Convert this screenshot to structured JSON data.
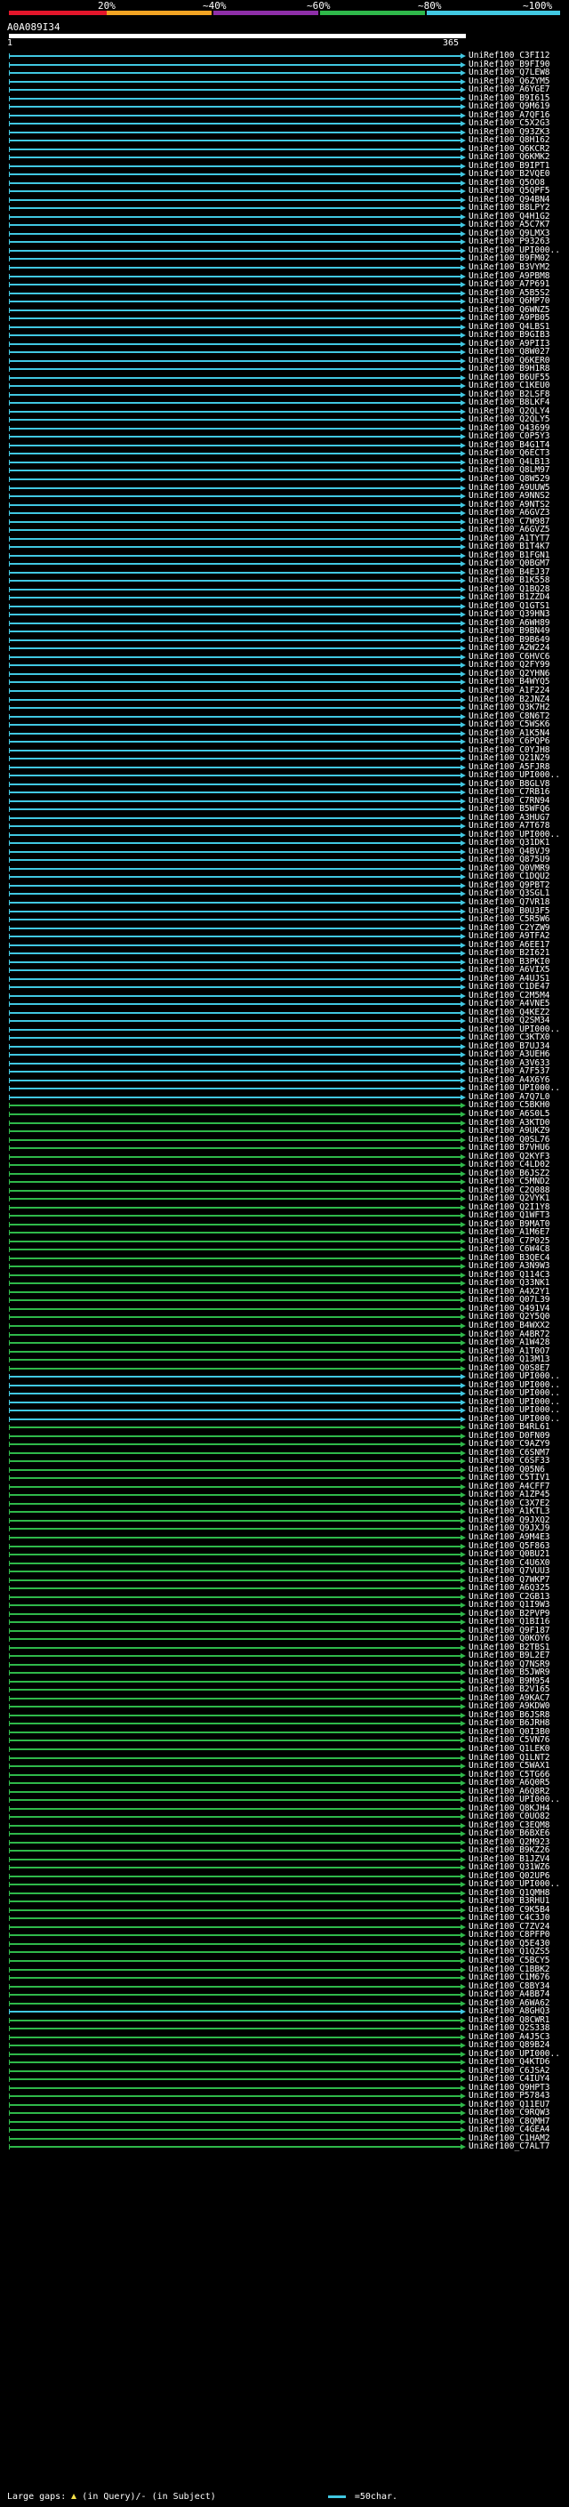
{
  "legend": {
    "labels": [
      "20%",
      "~40%",
      "~60%",
      "~80%",
      "~100%"
    ],
    "colors": [
      "#e3162b",
      "#f2a423",
      "#8e2fa8",
      "#2fb84a",
      "#41c8e2"
    ]
  },
  "query": {
    "name": "A0A089I34",
    "start": "1",
    "end": "365"
  },
  "footer": {
    "gaps_label": "Large gaps:",
    "gaps_text": "(in Query)/- (in Subject)",
    "scale_label": "=50char."
  },
  "hits": [
    {
      "label": "UniRef100_C3FI12",
      "color": "#41c8e2"
    },
    {
      "label": "UniRef100_B9FI90",
      "color": "#41c8e2"
    },
    {
      "label": "UniRef100_Q7LEW8",
      "color": "#41c8e2"
    },
    {
      "label": "UniRef100_Q6ZYM5",
      "color": "#41c8e2"
    },
    {
      "label": "UniRef100_A6YGE7",
      "color": "#41c8e2"
    },
    {
      "label": "UniRef100_B9I615",
      "color": "#41c8e2"
    },
    {
      "label": "UniRef100_Q9M619",
      "color": "#41c8e2"
    },
    {
      "label": "UniRef100_A7QF16",
      "color": "#41c8e2"
    },
    {
      "label": "UniRef100_C5X2G3",
      "color": "#41c8e2"
    },
    {
      "label": "UniRef100_Q93ZK3",
      "color": "#41c8e2"
    },
    {
      "label": "UniRef100_Q8H162",
      "color": "#41c8e2"
    },
    {
      "label": "UniRef100_Q6KCR2",
      "color": "#41c8e2"
    },
    {
      "label": "UniRef100_Q6KMK2",
      "color": "#41c8e2"
    },
    {
      "label": "UniRef100_B9IPT1",
      "color": "#41c8e2"
    },
    {
      "label": "UniRef100_B2VQE0",
      "color": "#41c8e2"
    },
    {
      "label": "UniRef100_Q5OO8",
      "color": "#41c8e2"
    },
    {
      "label": "UniRef100_Q5QPF5",
      "color": "#41c8e2"
    },
    {
      "label": "UniRef100_Q94BN4",
      "color": "#41c8e2"
    },
    {
      "label": "UniRef100_B8LPY2",
      "color": "#41c8e2"
    },
    {
      "label": "UniRef100_Q4H1G2",
      "color": "#41c8e2"
    },
    {
      "label": "UniRef100_A5C7K7",
      "color": "#41c8e2"
    },
    {
      "label": "UniRef100_Q9LMX3",
      "color": "#41c8e2"
    },
    {
      "label": "UniRef100_P93263",
      "color": "#41c8e2"
    },
    {
      "label": "UniRef100_UPI000..",
      "color": "#41c8e2"
    },
    {
      "label": "UniRef100_B9FM02",
      "color": "#41c8e2"
    },
    {
      "label": "UniRef100_B3VYM2",
      "color": "#41c8e2"
    },
    {
      "label": "UniRef100_A9PBM8",
      "color": "#41c8e2"
    },
    {
      "label": "UniRef100_A7P691",
      "color": "#41c8e2"
    },
    {
      "label": "UniRef100_A5B5S2",
      "color": "#41c8e2"
    },
    {
      "label": "UniRef100_Q6MP70",
      "color": "#41c8e2"
    },
    {
      "label": "UniRef100_Q6WNZ5",
      "color": "#41c8e2"
    },
    {
      "label": "UniRef100_A9PB05",
      "color": "#41c8e2"
    },
    {
      "label": "UniRef100_Q4LBS1",
      "color": "#41c8e2"
    },
    {
      "label": "UniRef100_B9GIB3",
      "color": "#41c8e2"
    },
    {
      "label": "UniRef100_A9PII3",
      "color": "#41c8e2"
    },
    {
      "label": "UniRef100_Q8W027",
      "color": "#41c8e2"
    },
    {
      "label": "UniRef100_Q6KER0",
      "color": "#41c8e2"
    },
    {
      "label": "UniRef100_B9H1R8",
      "color": "#41c8e2"
    },
    {
      "label": "UniRef100_B6UF55",
      "color": "#41c8e2"
    },
    {
      "label": "UniRef100_C1KEU0",
      "color": "#41c8e2"
    },
    {
      "label": "UniRef100_B2LSF8",
      "color": "#41c8e2"
    },
    {
      "label": "UniRef100_B8LKF4",
      "color": "#41c8e2"
    },
    {
      "label": "UniRef100_Q2QLY4",
      "color": "#41c8e2"
    },
    {
      "label": "UniRef100_Q2QLY5",
      "color": "#41c8e2"
    },
    {
      "label": "UniRef100_Q43699",
      "color": "#41c8e2"
    },
    {
      "label": "UniRef100_C0P5Y3",
      "color": "#41c8e2"
    },
    {
      "label": "UniRef100_B4G1T4",
      "color": "#41c8e2"
    },
    {
      "label": "UniRef100_Q6ECT3",
      "color": "#41c8e2"
    },
    {
      "label": "UniRef100_Q4LB13",
      "color": "#41c8e2"
    },
    {
      "label": "UniRef100_Q8LM97",
      "color": "#41c8e2"
    },
    {
      "label": "UniRef100_Q8W529",
      "color": "#41c8e2"
    },
    {
      "label": "UniRef100_A9UUW5",
      "color": "#41c8e2"
    },
    {
      "label": "UniRef100_A9NNS2",
      "color": "#41c8e2"
    },
    {
      "label": "UniRef100_A9NTS2",
      "color": "#41c8e2"
    },
    {
      "label": "UniRef100_A6GVZ3",
      "color": "#41c8e2"
    },
    {
      "label": "UniRef100_C7W987",
      "color": "#41c8e2"
    },
    {
      "label": "UniRef100_A6GVZ5",
      "color": "#41c8e2"
    },
    {
      "label": "UniRef100_A1TYT7",
      "color": "#41c8e2"
    },
    {
      "label": "UniRef100_B1T4K7",
      "color": "#41c8e2"
    },
    {
      "label": "UniRef100_B1FGN1",
      "color": "#41c8e2"
    },
    {
      "label": "UniRef100_Q0BGM7",
      "color": "#41c8e2"
    },
    {
      "label": "UniRef100_B4EJ37",
      "color": "#41c8e2"
    },
    {
      "label": "UniRef100_B1K558",
      "color": "#41c8e2"
    },
    {
      "label": "UniRef100_Q1BQ28",
      "color": "#41c8e2"
    },
    {
      "label": "UniRef100_B1ZZD4",
      "color": "#41c8e2"
    },
    {
      "label": "UniRef100_Q1GTS1",
      "color": "#41c8e2"
    },
    {
      "label": "UniRef100_Q39HN3",
      "color": "#41c8e2"
    },
    {
      "label": "UniRef100_A6WH89",
      "color": "#41c8e2"
    },
    {
      "label": "UniRef100_B9BN49",
      "color": "#41c8e2"
    },
    {
      "label": "UniRef100_B9B649",
      "color": "#41c8e2"
    },
    {
      "label": "UniRef100_A2W224",
      "color": "#41c8e2"
    },
    {
      "label": "UniRef100_C6HVC6",
      "color": "#41c8e2"
    },
    {
      "label": "UniRef100_Q2FY99",
      "color": "#41c8e2"
    },
    {
      "label": "UniRef100_Q2YHN6",
      "color": "#41c8e2"
    },
    {
      "label": "UniRef100_B4WYQ5",
      "color": "#41c8e2"
    },
    {
      "label": "UniRef100_A1F224",
      "color": "#41c8e2"
    },
    {
      "label": "UniRef100_B2JNZ4",
      "color": "#41c8e2"
    },
    {
      "label": "UniRef100_Q3K7H2",
      "color": "#41c8e2"
    },
    {
      "label": "UniRef100_C8N6T2",
      "color": "#41c8e2"
    },
    {
      "label": "UniRef100_C5WSK6",
      "color": "#41c8e2"
    },
    {
      "label": "UniRef100_A1K5N4",
      "color": "#41c8e2"
    },
    {
      "label": "UniRef100_C6PQP6",
      "color": "#41c8e2"
    },
    {
      "label": "UniRef100_C0YJH8",
      "color": "#41c8e2"
    },
    {
      "label": "UniRef100_Q21N29",
      "color": "#41c8e2"
    },
    {
      "label": "UniRef100_A5FJR8",
      "color": "#41c8e2"
    },
    {
      "label": "UniRef100_UPI000..",
      "color": "#41c8e2"
    },
    {
      "label": "UniRef100_B8GLV8",
      "color": "#41c8e2"
    },
    {
      "label": "UniRef100_C7RB16",
      "color": "#41c8e2"
    },
    {
      "label": "UniRef100_C7RN94",
      "color": "#41c8e2"
    },
    {
      "label": "UniRef100_B5WFQ6",
      "color": "#41c8e2"
    },
    {
      "label": "UniRef100_A3HUG7",
      "color": "#41c8e2"
    },
    {
      "label": "UniRef100_A7T678",
      "color": "#41c8e2"
    },
    {
      "label": "UniRef100_UPI000..",
      "color": "#41c8e2"
    },
    {
      "label": "UniRef100_Q31DK1",
      "color": "#41c8e2"
    },
    {
      "label": "UniRef100_Q4BVJ9",
      "color": "#41c8e2"
    },
    {
      "label": "UniRef100_Q875U9",
      "color": "#41c8e2"
    },
    {
      "label": "UniRef100_Q0VMR9",
      "color": "#41c8e2"
    },
    {
      "label": "UniRef100_C1DQU2",
      "color": "#41c8e2"
    },
    {
      "label": "UniRef100_Q9PBT2",
      "color": "#41c8e2"
    },
    {
      "label": "UniRef100_Q3SGL1",
      "color": "#41c8e2"
    },
    {
      "label": "UniRef100_Q7VR18",
      "color": "#41c8e2"
    },
    {
      "label": "UniRef100_B0U3F5",
      "color": "#41c8e2"
    },
    {
      "label": "UniRef100_C5R5W6",
      "color": "#41c8e2"
    },
    {
      "label": "UniRef100_C2YZW9",
      "color": "#41c8e2"
    },
    {
      "label": "UniRef100_A9TFA2",
      "color": "#41c8e2"
    },
    {
      "label": "UniRef100_A6EE17",
      "color": "#41c8e2"
    },
    {
      "label": "UniRef100_B2I621",
      "color": "#41c8e2"
    },
    {
      "label": "UniRef100_B3PKI0",
      "color": "#41c8e2"
    },
    {
      "label": "UniRef100_A6VIX5",
      "color": "#41c8e2"
    },
    {
      "label": "UniRef100_A4UJS1",
      "color": "#41c8e2"
    },
    {
      "label": "UniRef100_C1DE47",
      "color": "#41c8e2"
    },
    {
      "label": "UniRef100_C2M5M4",
      "color": "#41c8e2"
    },
    {
      "label": "UniRef100_A4VNE5",
      "color": "#41c8e2"
    },
    {
      "label": "UniRef100_Q4KEZ2",
      "color": "#41c8e2"
    },
    {
      "label": "UniRef100_Q2SM34",
      "color": "#41c8e2"
    },
    {
      "label": "UniRef100_UPI000..",
      "color": "#41c8e2"
    },
    {
      "label": "UniRef100_C3KTX0",
      "color": "#41c8e2"
    },
    {
      "label": "UniRef100_B7UJ34",
      "color": "#41c8e2"
    },
    {
      "label": "UniRef100_A3UEH6",
      "color": "#41c8e2"
    },
    {
      "label": "UniRef100_A3V633",
      "color": "#41c8e2"
    },
    {
      "label": "UniRef100_A7F537",
      "color": "#41c8e2"
    },
    {
      "label": "UniRef100_A4X6Y6",
      "color": "#41c8e2"
    },
    {
      "label": "UniRef100_UPI000..",
      "color": "#41c8e2"
    },
    {
      "label": "UniRef100_A7Q7L0",
      "color": "#41c8e2"
    },
    {
      "label": "UniRef100_C5BKH0",
      "color": "#2fb84a"
    },
    {
      "label": "UniRef100_A6S0L5",
      "color": "#2fb84a"
    },
    {
      "label": "UniRef100_A3KTD0",
      "color": "#2fb84a"
    },
    {
      "label": "UniRef100_A9UKZ9",
      "color": "#2fb84a"
    },
    {
      "label": "UniRef100_Q0SL76",
      "color": "#2fb84a"
    },
    {
      "label": "UniRef100_B7VHU6",
      "color": "#2fb84a"
    },
    {
      "label": "UniRef100_Q2KYF3",
      "color": "#2fb84a"
    },
    {
      "label": "UniRef100_C4LD02",
      "color": "#2fb84a"
    },
    {
      "label": "UniRef100_B6JSZ2",
      "color": "#2fb84a"
    },
    {
      "label": "UniRef100_C5MND2",
      "color": "#2fb84a"
    },
    {
      "label": "UniRef100_C2Q088",
      "color": "#2fb84a"
    },
    {
      "label": "UniRef100_Q2VYK1",
      "color": "#2fb84a"
    },
    {
      "label": "UniRef100_Q2I1Y8",
      "color": "#2fb84a"
    },
    {
      "label": "UniRef100_Q1WFT3",
      "color": "#2fb84a"
    },
    {
      "label": "UniRef100_B9MAT0",
      "color": "#2fb84a"
    },
    {
      "label": "UniRef100_A1M6E7",
      "color": "#2fb84a"
    },
    {
      "label": "UniRef100_C7P025",
      "color": "#2fb84a"
    },
    {
      "label": "UniRef100_C6W4C8",
      "color": "#2fb84a"
    },
    {
      "label": "UniRef100_B3QEC4",
      "color": "#2fb84a"
    },
    {
      "label": "UniRef100_A3N9W3",
      "color": "#2fb84a"
    },
    {
      "label": "UniRef100_Q114C3",
      "color": "#2fb84a"
    },
    {
      "label": "UniRef100_Q33NK1",
      "color": "#2fb84a"
    },
    {
      "label": "UniRef100_A4X2Y1",
      "color": "#2fb84a"
    },
    {
      "label": "UniRef100_Q07L39",
      "color": "#2fb84a"
    },
    {
      "label": "UniRef100_Q491V4",
      "color": "#2fb84a"
    },
    {
      "label": "UniRef100_Q2Y5Q0",
      "color": "#2fb84a"
    },
    {
      "label": "UniRef100_B4WXX2",
      "color": "#2fb84a"
    },
    {
      "label": "UniRef100_A4BR72",
      "color": "#2fb84a"
    },
    {
      "label": "UniRef100_A1W428",
      "color": "#2fb84a"
    },
    {
      "label": "UniRef100_A1T0O7",
      "color": "#2fb84a"
    },
    {
      "label": "UniRef100_Q13M13",
      "color": "#2fb84a"
    },
    {
      "label": "UniRef100_Q0S8E7",
      "color": "#2fb84a"
    },
    {
      "label": "UniRef100_UPI000..",
      "color": "#41c8e2"
    },
    {
      "label": "UniRef100_UPI000..",
      "color": "#41c8e2"
    },
    {
      "label": "UniRef100_UPI000..",
      "color": "#41c8e2"
    },
    {
      "label": "UniRef100_UPI000..",
      "color": "#41c8e2"
    },
    {
      "label": "UniRef100_UPI000..",
      "color": "#41c8e2"
    },
    {
      "label": "UniRef100_UPI000..",
      "color": "#41c8e2"
    },
    {
      "label": "UniRef100_B4RL61",
      "color": "#2fb84a"
    },
    {
      "label": "UniRef100_D0FN09",
      "color": "#2fb84a"
    },
    {
      "label": "UniRef100_C9AZY9",
      "color": "#2fb84a"
    },
    {
      "label": "UniRef100_C6SNM7",
      "color": "#2fb84a"
    },
    {
      "label": "UniRef100_C6SF33",
      "color": "#2fb84a"
    },
    {
      "label": "UniRef100_Q05N6",
      "color": "#2fb84a"
    },
    {
      "label": "UniRef100_C5TIV1",
      "color": "#2fb84a"
    },
    {
      "label": "UniRef100_A4CFF7",
      "color": "#2fb84a"
    },
    {
      "label": "UniRef100_A1ZP45",
      "color": "#2fb84a"
    },
    {
      "label": "UniRef100_C3X7E2",
      "color": "#2fb84a"
    },
    {
      "label": "UniRef100_A1KTL3",
      "color": "#2fb84a"
    },
    {
      "label": "UniRef100_Q9JXQ2",
      "color": "#2fb84a"
    },
    {
      "label": "UniRef100_Q9JXJ9",
      "color": "#2fb84a"
    },
    {
      "label": "UniRef100_A9M4E3",
      "color": "#2fb84a"
    },
    {
      "label": "UniRef100_Q5F863",
      "color": "#2fb84a"
    },
    {
      "label": "UniRef100_Q0BU21",
      "color": "#2fb84a"
    },
    {
      "label": "UniRef100_C4U6X0",
      "color": "#2fb84a"
    },
    {
      "label": "UniRef100_Q7VUU3",
      "color": "#2fb84a"
    },
    {
      "label": "UniRef100_Q7WKP7",
      "color": "#2fb84a"
    },
    {
      "label": "UniRef100_A6Q325",
      "color": "#2fb84a"
    },
    {
      "label": "UniRef100_C2GB13",
      "color": "#2fb84a"
    },
    {
      "label": "UniRef100_Q1I9W3",
      "color": "#2fb84a"
    },
    {
      "label": "UniRef100_B2PVP9",
      "color": "#2fb84a"
    },
    {
      "label": "UniRef100_Q1BI16",
      "color": "#2fb84a"
    },
    {
      "label": "UniRef100_Q9F187",
      "color": "#2fb84a"
    },
    {
      "label": "UniRef100_Q0KOY6",
      "color": "#2fb84a"
    },
    {
      "label": "UniRef100_B2TBS1",
      "color": "#2fb84a"
    },
    {
      "label": "UniRef100_B9L2E7",
      "color": "#2fb84a"
    },
    {
      "label": "UniRef100_Q7NSR9",
      "color": "#2fb84a"
    },
    {
      "label": "UniRef100_B5JWR9",
      "color": "#2fb84a"
    },
    {
      "label": "UniRef100_B9M954",
      "color": "#2fb84a"
    },
    {
      "label": "UniRef100_B2V165",
      "color": "#2fb84a"
    },
    {
      "label": "UniRef100_A9KAC7",
      "color": "#2fb84a"
    },
    {
      "label": "UniRef100_A9KDW0",
      "color": "#2fb84a"
    },
    {
      "label": "UniRef100_B6JSR8",
      "color": "#2fb84a"
    },
    {
      "label": "UniRef100_B6JRH8",
      "color": "#2fb84a"
    },
    {
      "label": "UniRef100_Q0I3B0",
      "color": "#2fb84a"
    },
    {
      "label": "UniRef100_C5VN76",
      "color": "#2fb84a"
    },
    {
      "label": "UniRef100_Q1LEK0",
      "color": "#2fb84a"
    },
    {
      "label": "UniRef100_Q1LNT2",
      "color": "#2fb84a"
    },
    {
      "label": "UniRef100_C5WAX1",
      "color": "#2fb84a"
    },
    {
      "label": "UniRef100_C5TG66",
      "color": "#2fb84a"
    },
    {
      "label": "UniRef100_A6Q0R5",
      "color": "#2fb84a"
    },
    {
      "label": "UniRef100_A6Q8R2",
      "color": "#2fb84a"
    },
    {
      "label": "UniRef100_UPI000..",
      "color": "#2fb84a"
    },
    {
      "label": "UniRef100_Q8KJH4",
      "color": "#2fb84a"
    },
    {
      "label": "UniRef100_C0UO82",
      "color": "#2fb84a"
    },
    {
      "label": "UniRef100_C3EQM8",
      "color": "#2fb84a"
    },
    {
      "label": "UniRef100_B6BXE6",
      "color": "#2fb84a"
    },
    {
      "label": "UniRef100_Q2M923",
      "color": "#2fb84a"
    },
    {
      "label": "UniRef100_B9KZ26",
      "color": "#2fb84a"
    },
    {
      "label": "UniRef100_B1JZV4",
      "color": "#2fb84a"
    },
    {
      "label": "UniRef100_Q31WZ6",
      "color": "#2fb84a"
    },
    {
      "label": "UniRef100_Q02UP6",
      "color": "#2fb84a"
    },
    {
      "label": "UniRef100_UPI000..",
      "color": "#2fb84a"
    },
    {
      "label": "UniRef100_Q1QMH8",
      "color": "#2fb84a"
    },
    {
      "label": "UniRef100_B3RHU1",
      "color": "#2fb84a"
    },
    {
      "label": "UniRef100_C9K5B4",
      "color": "#2fb84a"
    },
    {
      "label": "UniRef100_C4C3J0",
      "color": "#2fb84a"
    },
    {
      "label": "UniRef100_C7ZV24",
      "color": "#2fb84a"
    },
    {
      "label": "UniRef100_C8PFP0",
      "color": "#2fb84a"
    },
    {
      "label": "UniRef100_Q5E430",
      "color": "#2fb84a"
    },
    {
      "label": "UniRef100_Q1QZS5",
      "color": "#2fb84a"
    },
    {
      "label": "UniRef100_C5BCY5",
      "color": "#2fb84a"
    },
    {
      "label": "UniRef100_C1BBK2",
      "color": "#2fb84a"
    },
    {
      "label": "UniRef100_C1M676",
      "color": "#2fb84a"
    },
    {
      "label": "UniRef100_C8BY34",
      "color": "#2fb84a"
    },
    {
      "label": "UniRef100_A4BB74",
      "color": "#2fb84a"
    },
    {
      "label": "UniRef100_A6WA62",
      "color": "#2fb84a"
    },
    {
      "label": "UniRef100_A8GHQ3",
      "color": "#41c8e2"
    },
    {
      "label": "UniRef100_Q8CWR1",
      "color": "#2fb84a"
    },
    {
      "label": "UniRef100_Q2S338",
      "color": "#2fb84a"
    },
    {
      "label": "UniRef100_A4J5C3",
      "color": "#2fb84a"
    },
    {
      "label": "UniRef100_Q89B24",
      "color": "#2fb84a"
    },
    {
      "label": "UniRef100_UPI000..",
      "color": "#2fb84a"
    },
    {
      "label": "UniRef100_Q4KTD6",
      "color": "#2fb84a"
    },
    {
      "label": "UniRef100_C6JSA2",
      "color": "#2fb84a"
    },
    {
      "label": "UniRef100_C4IUY4",
      "color": "#2fb84a"
    },
    {
      "label": "UniRef100_Q9HPT3",
      "color": "#2fb84a"
    },
    {
      "label": "UniRef100_P57843",
      "color": "#2fb84a"
    },
    {
      "label": "UniRef100_Q11EU7",
      "color": "#2fb84a"
    },
    {
      "label": "UniRef100_C9RQW3",
      "color": "#2fb84a"
    },
    {
      "label": "UniRef100_C8QMH7",
      "color": "#2fb84a"
    },
    {
      "label": "UniRef100_C4GEA4",
      "color": "#2fb84a"
    },
    {
      "label": "UniRef100_C1HAM2",
      "color": "#2fb84a"
    },
    {
      "label": "UniRef100_C7ALT7",
      "color": "#2fb84a"
    }
  ]
}
